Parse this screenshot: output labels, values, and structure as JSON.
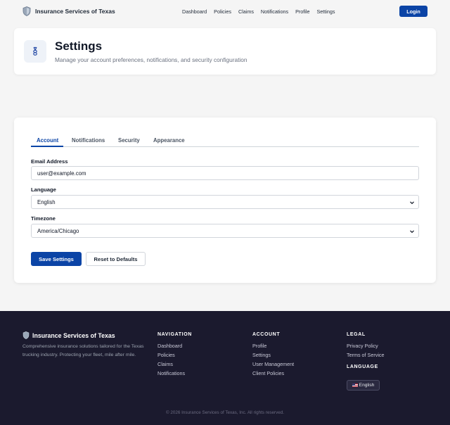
{
  "app": {
    "brand": "Insurance Services of Texas"
  },
  "nav": {
    "links": [
      "Dashboard",
      "Policies",
      "Claims",
      "Notifications",
      "Profile",
      "Settings"
    ],
    "login_label": "Login"
  },
  "header": {
    "title": "Settings",
    "subtitle": "Manage your account preferences, notifications, and security configuration"
  },
  "tabs": [
    "Account",
    "Notifications",
    "Security",
    "Appearance"
  ],
  "form": {
    "email_label": "Email Address",
    "email_value": "user@example.com",
    "language_label": "Language",
    "language_value": "English",
    "timezone_label": "Timezone",
    "timezone_value": "America/Chicago",
    "save_label": "Save Settings",
    "reset_label": "Reset to Defaults"
  },
  "footer": {
    "brand": "Insurance Services of Texas",
    "description": "Comprehensive insurance solutions tailored for the Texas trucking industry. Protecting your fleet, mile after mile.",
    "navigation": {
      "heading": "NAVIGATION",
      "links": [
        "Dashboard",
        "Policies",
        "Claims",
        "Notifications"
      ]
    },
    "account": {
      "heading": "ACCOUNT",
      "links": [
        "Profile",
        "Settings",
        "User Management",
        "Client Policies"
      ]
    },
    "legal": {
      "heading": "LEGAL",
      "links": [
        "Privacy Policy",
        "Terms of Service"
      ]
    },
    "language": {
      "heading": "LANGUAGE",
      "button": "English"
    },
    "copyright": "© 2026 Insurance Services of Texas, Inc. All rights reserved."
  },
  "colors": {
    "primary": "#0b44a6",
    "footer_bg": "#1b1a2e",
    "page_bg": "#f5f5f5"
  },
  "icons": {
    "brand": "shield-icon",
    "settings": "settings-link-icon",
    "select": "chevron-down-icon",
    "language": "us-flag-icon"
  }
}
